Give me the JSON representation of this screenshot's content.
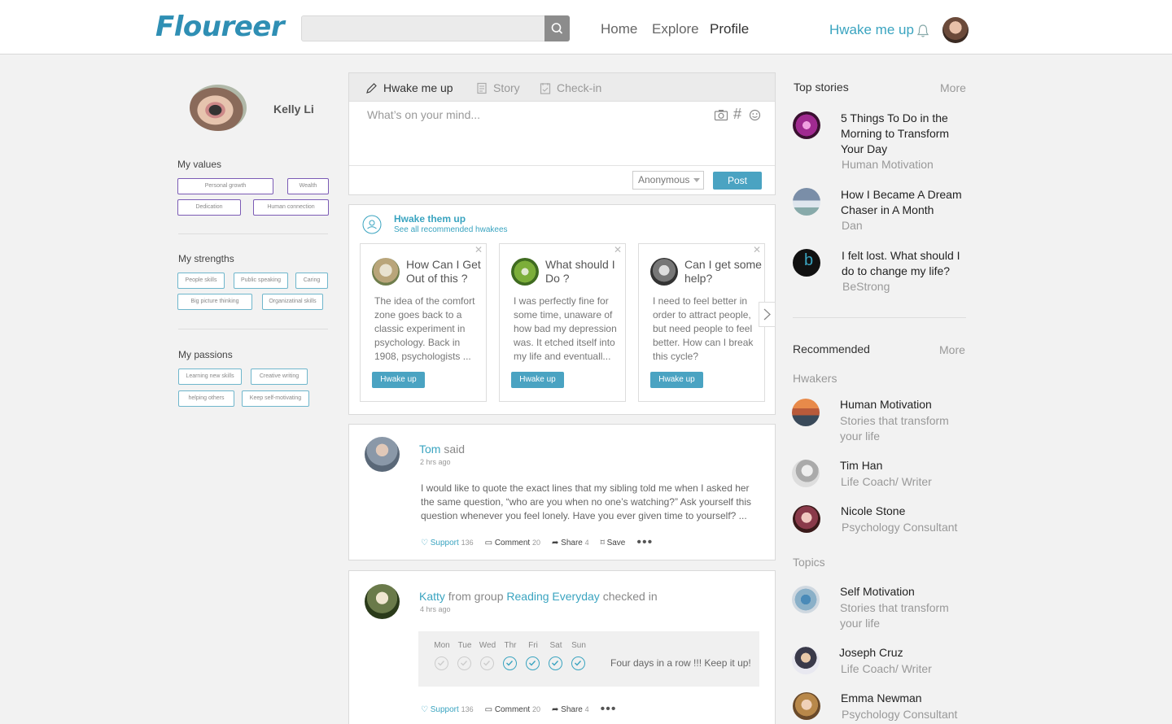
{
  "header": {
    "logo": "Floureer",
    "search": {
      "placeholder": "",
      "value": ""
    },
    "nav": [
      "Home",
      "Explore",
      "Profile"
    ],
    "active_nav": "Profile",
    "hwake_link": "Hwake me up"
  },
  "profile": {
    "name": "Kelly Li",
    "values_title": "My values",
    "values": [
      "Personal growth",
      "Wealth",
      "Dedication",
      "Human connection"
    ],
    "strengths_title": "My strengths",
    "strengths": [
      "People skills",
      "Public speaking",
      "Caring",
      "Big picture thinking",
      "Organizatinal skills"
    ],
    "passions_title": "My passions",
    "passions": [
      "Learning new skills",
      "Creative writing",
      "helping others",
      "Keep self-motivating"
    ]
  },
  "composer": {
    "tabs": [
      "Hwake me up",
      "Story",
      "Check-in"
    ],
    "placeholder": "What’s on your mind...",
    "visibility": "Anonymous",
    "post_label": "Post"
  },
  "hwake_them_up": {
    "title": "Hwake them up",
    "link": "See all recommended hwakees",
    "button_label": "Hwake up",
    "cards": [
      {
        "title": "How Can I Get Out of this ?",
        "body": "The idea of the comfort zone goes back to a classic experiment in psychology. Back in 1908, psychologists ..."
      },
      {
        "title": "What should I Do ?",
        "body": "I was perfectly fine for some time, unaware of how bad my depression was. It etched itself into my life and eventuall..."
      },
      {
        "title": "Can I get some help?",
        "body": "I need to feel better in order to attract people, but need people to feel better. How can I break this cycle?"
      }
    ]
  },
  "posts": [
    {
      "author": "Tom",
      "verb": "said",
      "time": "2 hrs ago",
      "body": "I would like to quote the exact lines that my sibling told me when I asked her the same question, “who are you when no one’s watching?” Ask yourself this question whenever you feel lonely. Have you ever given time to yourself? ...",
      "support": "Support",
      "support_count": "136",
      "comment": "Comment",
      "comment_count": "20",
      "share": "Share",
      "share_count": "4",
      "save": "Save"
    },
    {
      "author": "Katty",
      "verb": "from group",
      "group": "Reading Everyday",
      "verb2": "checked in",
      "time": "4 hrs ago",
      "days": [
        "Mon",
        "Tue",
        "Wed",
        "Thr",
        "Fri",
        "Sat",
        "Sun"
      ],
      "days_done": [
        false,
        false,
        false,
        true,
        true,
        true,
        true
      ],
      "checkin_msg": "Four days in a row !!! Keep it up!",
      "support": "Support",
      "support_count": "136",
      "comment": "Comment",
      "comment_count": "20",
      "share": "Share",
      "share_count": "4"
    }
  ],
  "top_stories": {
    "title": "Top stories",
    "more": "More",
    "items": [
      {
        "title": "5 Things To Do in the Morning to Transform Your Day",
        "source": "Human Motivation"
      },
      {
        "title": "How I Became A Dream Chaser in A Month",
        "source": "Dan"
      },
      {
        "title": "I felt lost. What should I do to change my life?",
        "source": "BeStrong"
      }
    ]
  },
  "recommended": {
    "title": "Recommended",
    "more": "More",
    "hwakers_title": "Hwakers",
    "hwakers": [
      {
        "name": "Human Motivation",
        "desc": "Stories that transform your life"
      },
      {
        "name": "Tim Han",
        "desc": "Life Coach/ Writer"
      },
      {
        "name": "Nicole Stone",
        "desc": "Psychology Consultant"
      }
    ],
    "topics_title": "Topics",
    "topics": [
      {
        "name": "Self Motivation",
        "desc": "Stories that transform your life"
      },
      {
        "name": "Joseph Cruz",
        "desc": "Life Coach/ Writer"
      },
      {
        "name": "Emma Newman",
        "desc": "Psychology Consultant"
      }
    ]
  },
  "colors": {
    "accent": "#3aa4c0",
    "button": "#4aa3c2",
    "value_border": "#7b5bb5",
    "strength_border": "#6fb6cc"
  }
}
